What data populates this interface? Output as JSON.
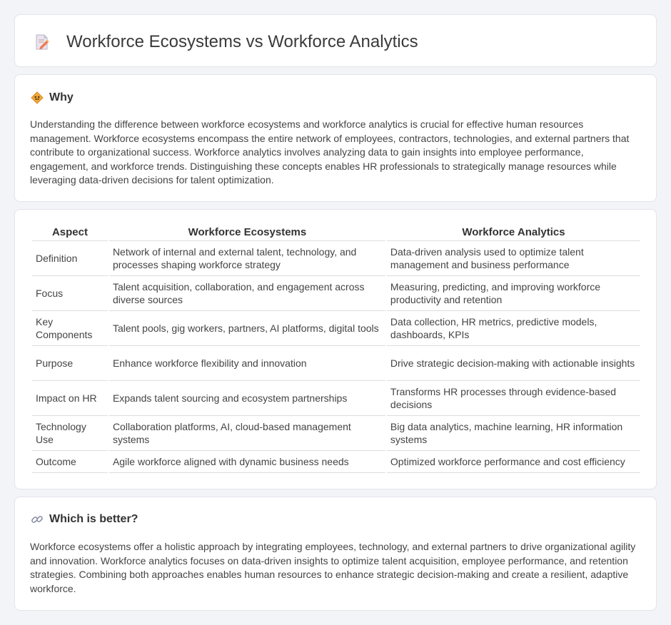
{
  "header": {
    "title": "Workforce Ecosystems vs Workforce Analytics",
    "icon": "document-pencil-icon"
  },
  "why": {
    "heading": "Why",
    "icon": "diamond-road-sign-icon",
    "text": "Understanding the difference between workforce ecosystems and workforce analytics is crucial for effective human resources management. Workforce ecosystems encompass the entire network of employees, contractors, technologies, and external partners that contribute to organizational success. Workforce analytics involves analyzing data to gain insights into employee performance, engagement, and workforce trends. Distinguishing these concepts enables HR professionals to strategically manage resources while leveraging data-driven decisions for talent optimization."
  },
  "comparison": {
    "headers": [
      "Aspect",
      "Workforce Ecosystems",
      "Workforce Analytics"
    ],
    "rows": [
      [
        "Definition",
        "Network of internal and external talent, technology, and processes shaping workforce strategy",
        "Data-driven analysis used to optimize talent management and business performance"
      ],
      [
        "Focus",
        "Talent acquisition, collaboration, and engagement across diverse sources",
        "Measuring, predicting, and improving workforce productivity and retention"
      ],
      [
        "Key Components",
        "Talent pools, gig workers, partners, AI platforms, digital tools",
        "Data collection, HR metrics, predictive models, dashboards, KPIs"
      ],
      [
        "Purpose",
        "Enhance workforce flexibility and innovation",
        "Drive strategic decision-making with actionable insights"
      ],
      [
        "Impact on HR",
        "Expands talent sourcing and ecosystem partnerships",
        "Transforms HR processes through evidence-based decisions"
      ],
      [
        "Technology Use",
        "Collaboration platforms, AI, cloud-based management systems",
        "Big data analytics, machine learning, HR information systems"
      ],
      [
        "Outcome",
        "Agile workforce aligned with dynamic business needs",
        "Optimized workforce performance and cost efficiency"
      ]
    ]
  },
  "better": {
    "heading": "Which is better?",
    "icon": "link-icon",
    "text": "Workforce ecosystems offer a holistic approach by integrating employees, technology, and external partners to drive organizational agility and innovation. Workforce analytics focuses on data-driven insights to optimize talent acquisition, employee performance, and retention strategies. Combining both approaches enables human resources to enhance strategic decision-making and create a resilient, adaptive workforce."
  }
}
